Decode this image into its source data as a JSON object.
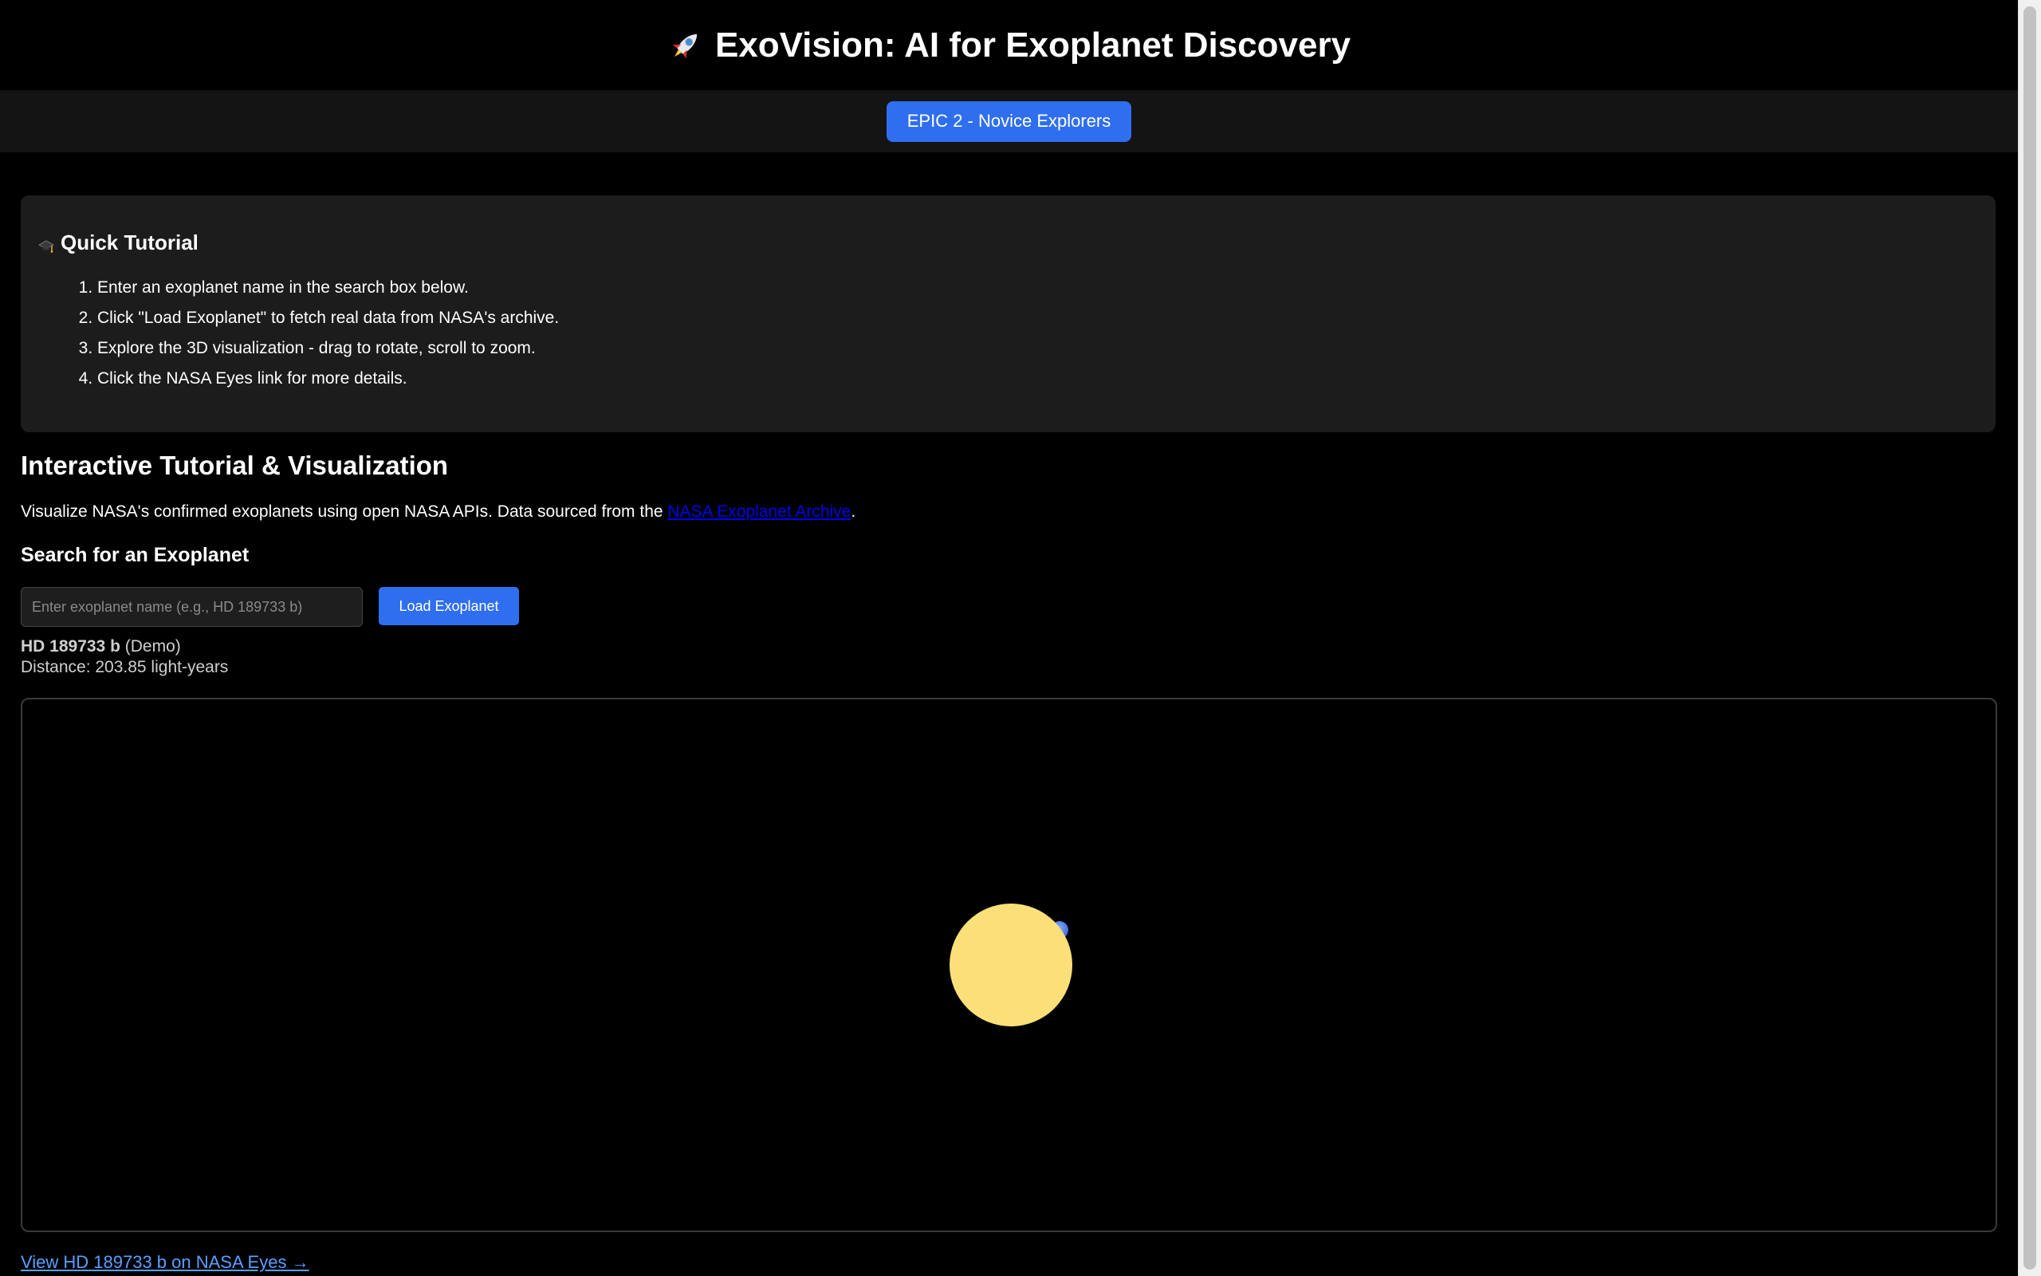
{
  "header": {
    "title": "ExoVision: AI for Exoplanet Discovery",
    "icon": "rocket-icon"
  },
  "nav": {
    "epic_button": "EPIC 2 - Novice Explorers"
  },
  "tutorial": {
    "icon": "graduation-cap-icon",
    "title": "Quick Tutorial",
    "steps": [
      "Enter an exoplanet name in the search box below.",
      "Click \"Load Exoplanet\" to fetch real data from NASA's archive.",
      "Explore the 3D visualization - drag to rotate, scroll to zoom.",
      "Click the NASA Eyes link for more details."
    ]
  },
  "main": {
    "title": "Interactive Tutorial & Visualization",
    "description_prefix": "Visualize NASA's confirmed exoplanets using open NASA APIs. Data sourced from the ",
    "archive_link": "NASA Exoplanet Archive",
    "description_suffix": "."
  },
  "search": {
    "title": "Search for an Exoplanet",
    "placeholder": "Enter exoplanet name (e.g., HD 189733 b)",
    "value": "",
    "button": "Load Exoplanet"
  },
  "planet": {
    "name": "HD 189733 b",
    "tag": "(Demo)",
    "distance_label": "Distance: 203.85 light-years"
  },
  "visualization": {
    "star_color": "#fbe07a",
    "planet_color": "#4a7bff"
  },
  "footer": {
    "eyes_link": "View HD 189733 b on NASA Eyes →"
  },
  "colors": {
    "accent": "#2f6fef",
    "link": "#0000ee",
    "footer_link": "#5aa0ff"
  }
}
